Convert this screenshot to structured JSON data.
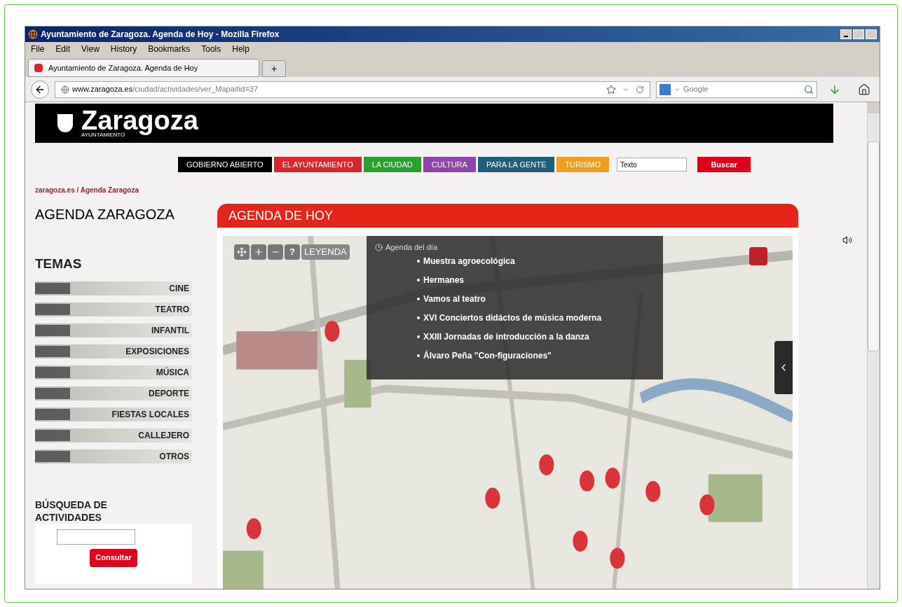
{
  "window": {
    "title": "Ayuntamiento de Zaragoza. Agenda de Hoy - Mozilla Firefox"
  },
  "menu": [
    "File",
    "Edit",
    "View",
    "History",
    "Bookmarks",
    "Tools",
    "Help"
  ],
  "tabs": [
    {
      "label": "Ayuntamiento de Zaragoza. Agenda de Hoy",
      "selected": true
    },
    {
      "label": "+",
      "selected": false
    }
  ],
  "address": {
    "host": "www.zaragoza.es",
    "path": "/ciudad/actividades/ver_Mapa#id=37"
  },
  "search": {
    "engine": "Google"
  },
  "banner": {
    "logo": "Zaragoza",
    "sublogo": "AYUNTAMIENTO"
  },
  "nav": [
    {
      "label": "GOBIERNO ABIERTO",
      "color": "#000000"
    },
    {
      "label": "EL AYUNTAMIENTO",
      "color": "#d9262b"
    },
    {
      "label": "LA CIUDAD",
      "color": "#2aa12f"
    },
    {
      "label": "CULTURA",
      "color": "#8e44ad"
    },
    {
      "label": "PARA LA GENTE",
      "color": "#1f5f7a"
    },
    {
      "label": "TURISMO",
      "color": "#f39c22"
    }
  ],
  "site_search": {
    "value": "Texto",
    "button": "Buscar"
  },
  "breadcrumb": "zaragoza.es / Agenda Zaragoza",
  "page_title": "AGENDA ZARAGOZA",
  "temas": {
    "title": "TEMAS",
    "items": [
      "CINE",
      "TEATRO",
      "INFANTIL",
      "EXPOSICIONES",
      "MÚSICA",
      "DEPORTE",
      "FIESTAS LOCALES",
      "CALLEJERO",
      "OTROS"
    ]
  },
  "busqueda": {
    "title": "BÚSQUEDA DE ACTIVIDADES",
    "button": "Consultar"
  },
  "agenda": {
    "title": "AGENDA DE HOY",
    "help": "?",
    "legend": "LEYENDA",
    "popup_title": "Agenda del día",
    "events": [
      "Muestra agroecológica",
      "Hermanes",
      "Vamos al teatro",
      "XVI Conciertos didáctos de música moderna",
      "XXIII Jornadas de introducción a la danza",
      "Álvaro Peña \"Con-figuraciones\""
    ]
  }
}
